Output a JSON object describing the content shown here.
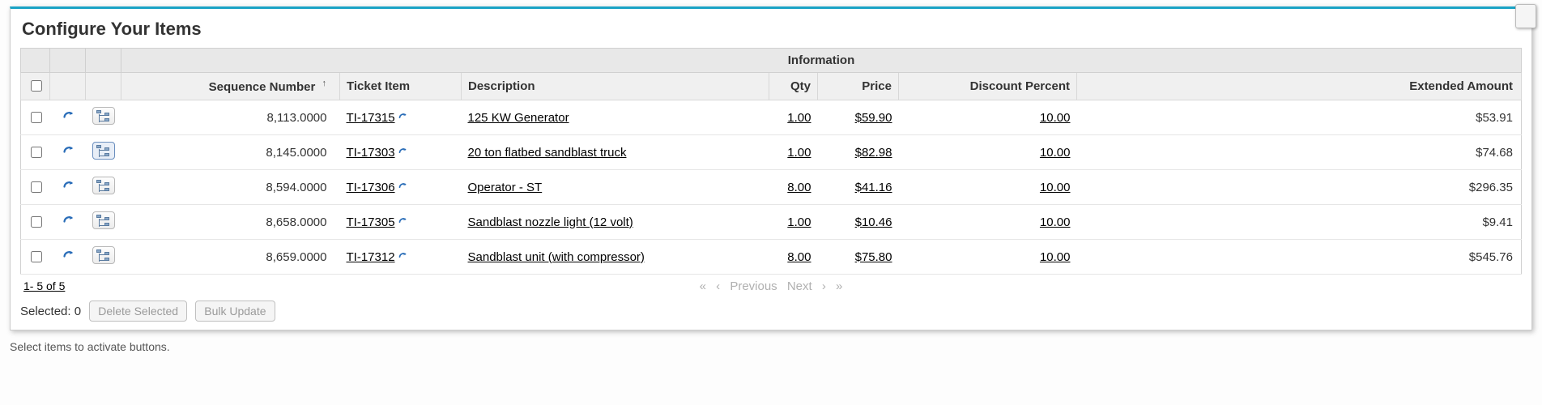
{
  "title": "Configure Your Items",
  "group_header": "Information",
  "columns": {
    "sequence": "Sequence Number",
    "ticket": "Ticket Item",
    "description": "Description",
    "qty": "Qty",
    "price": "Price",
    "discount": "Discount Percent",
    "extended": "Extended Amount"
  },
  "sort_indicator": "↑",
  "rows": [
    {
      "sequence": "8,113.0000",
      "ticket": "TI-17315",
      "description": "125 KW Generator",
      "qty": "1.00",
      "price": "$59.90",
      "discount": "10.00",
      "extended": "$53.91",
      "expanded": false
    },
    {
      "sequence": "8,145.0000",
      "ticket": "TI-17303",
      "description": "20 ton flatbed sandblast truck",
      "qty": "1.00",
      "price": "$82.98",
      "discount": "10.00",
      "extended": "$74.68",
      "expanded": true
    },
    {
      "sequence": "8,594.0000",
      "ticket": "TI-17306",
      "description": "Operator - ST",
      "qty": "8.00",
      "price": "$41.16",
      "discount": "10.00",
      "extended": "$296.35",
      "expanded": false
    },
    {
      "sequence": "8,658.0000",
      "ticket": "TI-17305",
      "description": "Sandblast nozzle light (12 volt)",
      "qty": "1.00",
      "price": "$10.46",
      "discount": "10.00",
      "extended": "$9.41",
      "expanded": false
    },
    {
      "sequence": "8,659.0000",
      "ticket": "TI-17312",
      "description": "Sandblast unit (with compressor)",
      "qty": "8.00",
      "price": "$75.80",
      "discount": "10.00",
      "extended": "$545.76",
      "expanded": false
    }
  ],
  "pager": {
    "range": "1- 5  of  5",
    "previous": "Previous",
    "next": "Next"
  },
  "toolbar": {
    "selected_label": "Selected:",
    "selected_count": "0",
    "delete_label": "Delete Selected",
    "bulk_label": "Bulk Update"
  },
  "hint": "Select items to activate buttons."
}
